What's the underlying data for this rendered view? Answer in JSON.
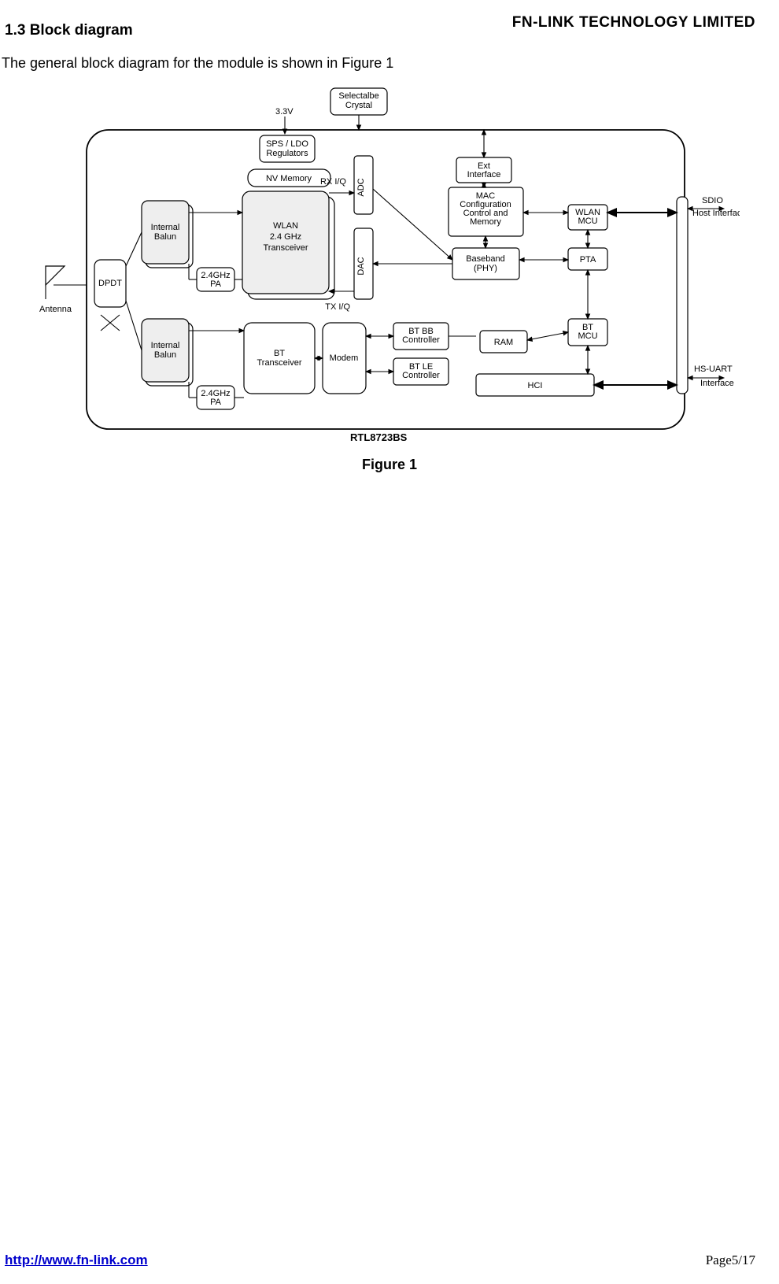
{
  "header": {
    "company": "FN-LINK TECHNOLOGY LIMITED"
  },
  "section": {
    "heading": "1.3 Block diagram"
  },
  "intro": {
    "text": "The general block diagram for the module is shown in Figure 1"
  },
  "figure": {
    "caption": "Figure 1"
  },
  "footer": {
    "link": "http://www.fn-link.com",
    "page": "Page5/17"
  },
  "diagram": {
    "chip_name": "RTL8723BS",
    "ext_top": {
      "crystal": "Selectalbe\nCrystal",
      "voltage": "3.3V"
    },
    "ext_left": {
      "antenna": "Antenna"
    },
    "ext_right": {
      "sdio_line1": "SDIO",
      "sdio_line2": "Host Interface",
      "hsuart_line1": "HS-UART",
      "hsuart_line2": "Interface"
    },
    "blocks": {
      "sps_ldo": "SPS / LDO\nRegulators",
      "nv_memory": "NV Memory",
      "dpdt": "DPDT",
      "balun_top": "Internal\nBalun",
      "balun_bot": "Internal\nBalun",
      "pa_top": "2.4GHz\nPA",
      "pa_bot": "2.4GHz\nPA",
      "wlan_xcvr": "WLAN\n2.4 GHz\nTransceiver",
      "bt_xcvr": "BT\nTransceiver",
      "modem": "Modem",
      "adc": "ADC",
      "dac": "DAC",
      "ext_if": "Ext\nInterface",
      "mac_cfg": "MAC\nConfiguration\nControl and\nMemory",
      "baseband": "Baseband\n(PHY)",
      "bt_bb": "BT BB\nController",
      "bt_le": "BT LE\nController",
      "ram": "RAM",
      "hci": "HCI",
      "wlan_mcu": "WLAN\nMCU",
      "pta": "PTA",
      "bt_mcu": "BT\nMCU"
    },
    "signals": {
      "rx_iq": "RX I/Q",
      "tx_iq": "TX I/Q"
    }
  }
}
